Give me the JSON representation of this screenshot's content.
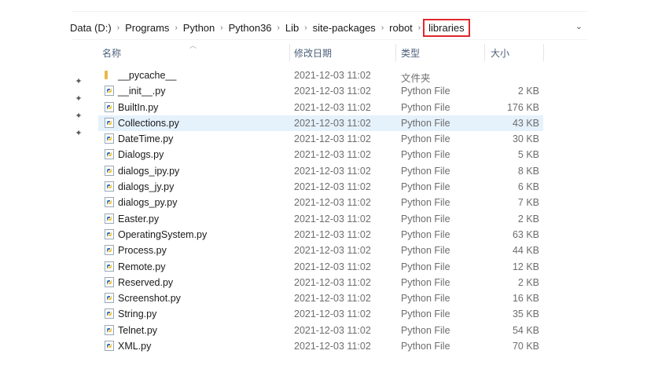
{
  "breadcrumb": {
    "segments": [
      "Data (D:)",
      "Programs",
      "Python",
      "Python36",
      "Lib",
      "site-packages",
      "robot",
      "libraries"
    ]
  },
  "columns": {
    "name": "名称",
    "date": "修改日期",
    "type": "类型",
    "size": "大小"
  },
  "files": [
    {
      "name": "__pycache__",
      "date": "2021-12-03 11:02",
      "type": "文件夹",
      "size": "",
      "kind": "folder"
    },
    {
      "name": "__init__.py",
      "date": "2021-12-03 11:02",
      "type": "Python File",
      "size": "2 KB",
      "kind": "py"
    },
    {
      "name": "BuiltIn.py",
      "date": "2021-12-03 11:02",
      "type": "Python File",
      "size": "176 KB",
      "kind": "py"
    },
    {
      "name": "Collections.py",
      "date": "2021-12-03 11:02",
      "type": "Python File",
      "size": "43 KB",
      "kind": "py",
      "selected": true
    },
    {
      "name": "DateTime.py",
      "date": "2021-12-03 11:02",
      "type": "Python File",
      "size": "30 KB",
      "kind": "py"
    },
    {
      "name": "Dialogs.py",
      "date": "2021-12-03 11:02",
      "type": "Python File",
      "size": "5 KB",
      "kind": "py"
    },
    {
      "name": "dialogs_ipy.py",
      "date": "2021-12-03 11:02",
      "type": "Python File",
      "size": "8 KB",
      "kind": "py"
    },
    {
      "name": "dialogs_jy.py",
      "date": "2021-12-03 11:02",
      "type": "Python File",
      "size": "6 KB",
      "kind": "py"
    },
    {
      "name": "dialogs_py.py",
      "date": "2021-12-03 11:02",
      "type": "Python File",
      "size": "7 KB",
      "kind": "py"
    },
    {
      "name": "Easter.py",
      "date": "2021-12-03 11:02",
      "type": "Python File",
      "size": "2 KB",
      "kind": "py"
    },
    {
      "name": "OperatingSystem.py",
      "date": "2021-12-03 11:02",
      "type": "Python File",
      "size": "63 KB",
      "kind": "py"
    },
    {
      "name": "Process.py",
      "date": "2021-12-03 11:02",
      "type": "Python File",
      "size": "44 KB",
      "kind": "py"
    },
    {
      "name": "Remote.py",
      "date": "2021-12-03 11:02",
      "type": "Python File",
      "size": "12 KB",
      "kind": "py"
    },
    {
      "name": "Reserved.py",
      "date": "2021-12-03 11:02",
      "type": "Python File",
      "size": "2 KB",
      "kind": "py"
    },
    {
      "name": "Screenshot.py",
      "date": "2021-12-03 11:02",
      "type": "Python File",
      "size": "16 KB",
      "kind": "py"
    },
    {
      "name": "String.py",
      "date": "2021-12-03 11:02",
      "type": "Python File",
      "size": "35 KB",
      "kind": "py"
    },
    {
      "name": "Telnet.py",
      "date": "2021-12-03 11:02",
      "type": "Python File",
      "size": "54 KB",
      "kind": "py"
    },
    {
      "name": "XML.py",
      "date": "2021-12-03 11:02",
      "type": "Python File",
      "size": "70 KB",
      "kind": "py"
    }
  ],
  "colors": {
    "highlight": "#e0282e",
    "selection": "#e5f1fb",
    "header_text": "#4c607a"
  }
}
